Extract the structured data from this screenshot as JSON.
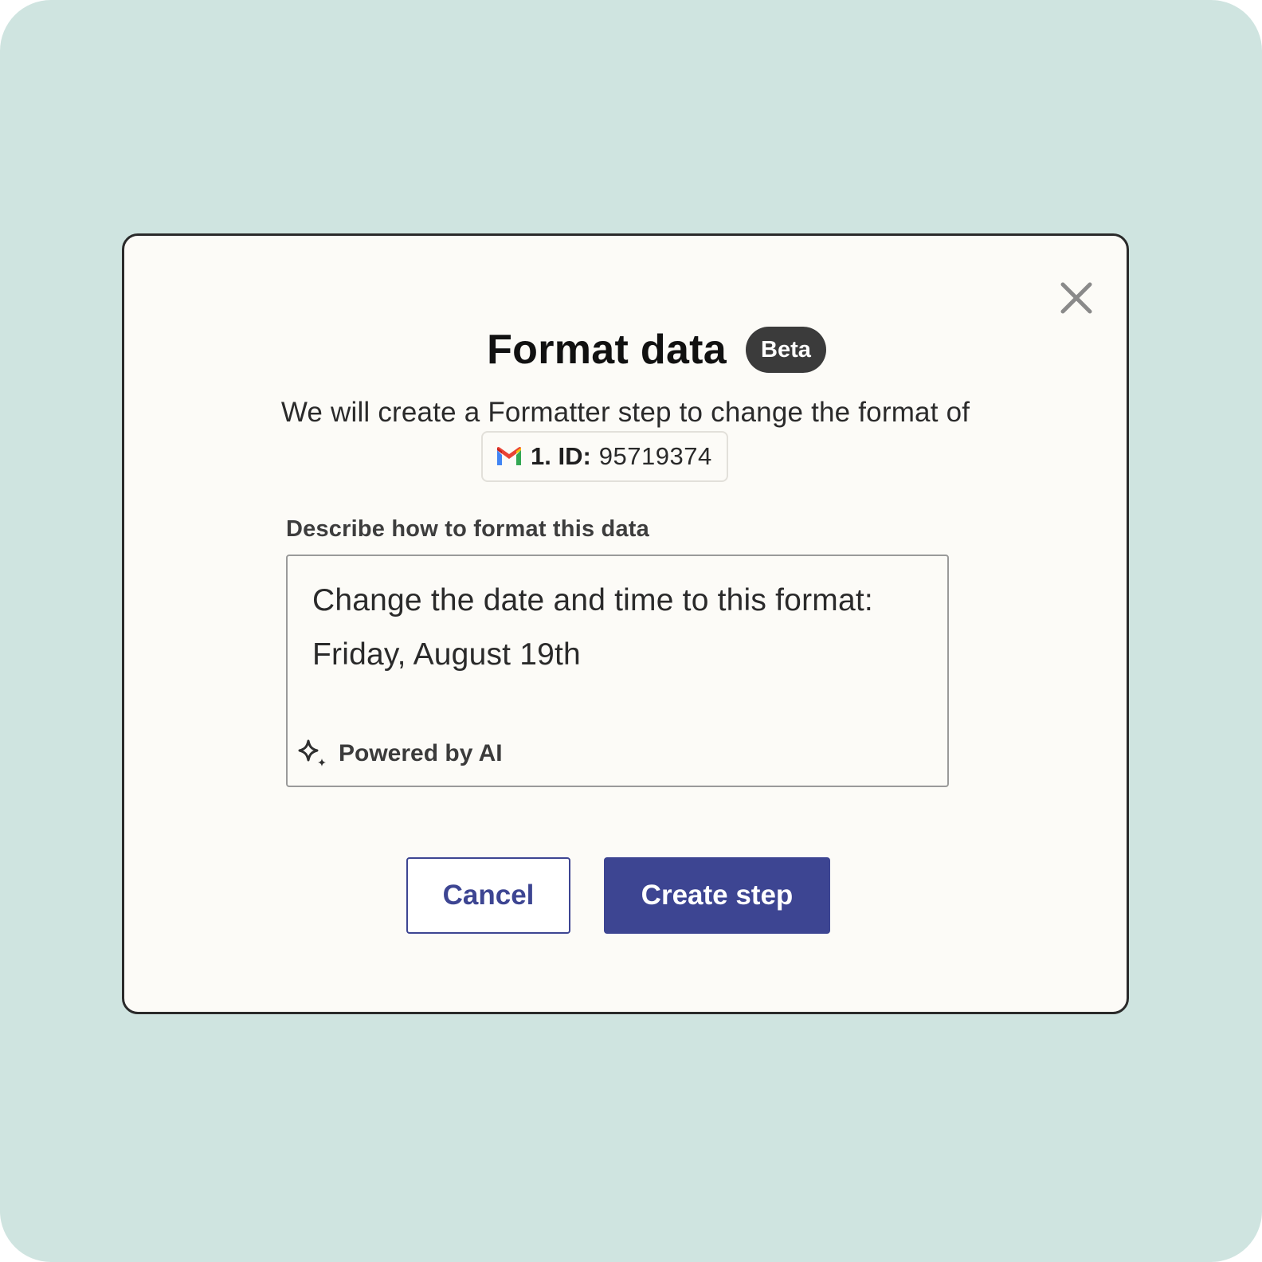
{
  "dialog": {
    "title": "Format data",
    "badge": "Beta",
    "description": "We will create a Formatter step to change the format of",
    "chip": {
      "icon": "gmail-icon",
      "label": "1. ID:",
      "value": "95719374"
    },
    "field": {
      "label": "Describe how to format this data",
      "value": "Change the date and time to this format:\nFriday, August 19th"
    },
    "powered_by": {
      "icon": "sparkle-icon",
      "label": "Powered by AI"
    },
    "buttons": {
      "cancel": "Cancel",
      "create": "Create step"
    },
    "close_icon": "close-icon"
  },
  "colors": {
    "background": "#cfe4e0",
    "modal": "#fcfbf7",
    "primary": "#3d4592",
    "badge": "#3b3b3b"
  }
}
